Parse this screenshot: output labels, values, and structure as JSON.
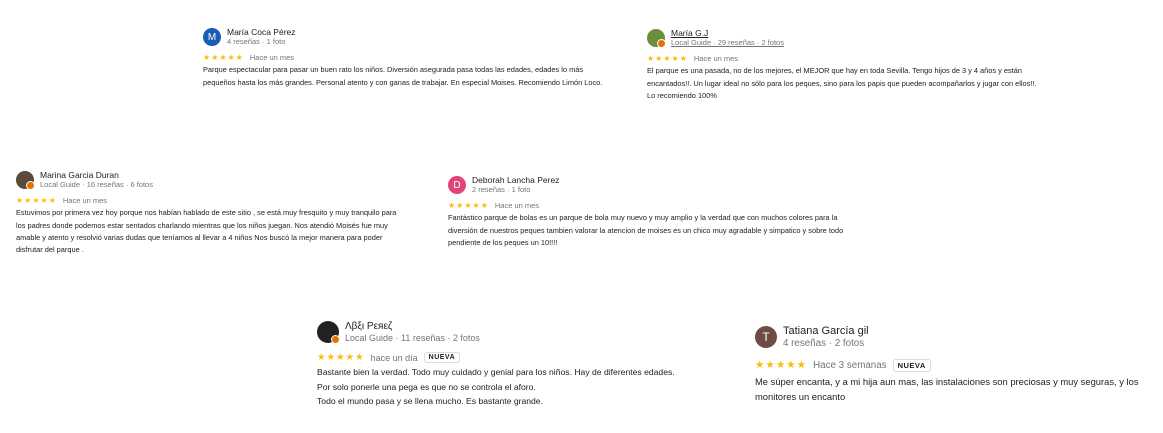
{
  "colors": {
    "stars": "#fbbc04",
    "meta": "#70757a",
    "text": "#202124"
  },
  "reviews": [
    {
      "name": "María Coca Pérez",
      "meta": "4 reseñas · 1 foto",
      "avatar_letter": "M",
      "avatar_color": "#1a5db4",
      "stars": "★★★★★",
      "rating": 5,
      "time": "Hace un mes",
      "text": "Parque espectacular para pasar un buen rato los niños. Diversión asegurada pasa todas las edades, edades lo más pequeños hasta los más grandes. Personal atento y con ganas de trabajar. En especial Moises. Recomiendo Limón Loco."
    },
    {
      "name": "María G.J",
      "meta": "Local Guide · 29 reseñas · 2 fotos",
      "avatar_letter": "",
      "avatar_color": "#6a8f3a",
      "stars": "★★★★★",
      "rating": 5,
      "time": "Hace un mes",
      "text": "El parque es una pasada, no de los mejores, el MEJOR que hay en toda Sevilla. Tengo hijos de 3 y 4 años y están encantados!!. Un lugar ideal no sólo para los peques, sino para los papis que pueden acompañarlos y jugar con ellos!!. Lo recomiendo 100%"
    },
    {
      "name": "Marina Garcia Duran",
      "meta": "Local Guide · 16 reseñas · 6 fotos",
      "avatar_letter": "",
      "avatar_color": "#5b4a3a",
      "stars": "★★★★★",
      "rating": 5,
      "time": "Hace un mes",
      "text": "Estuvimos por primera vez hoy  porque nos habían hablado de este sitio , se está muy fresquito y muy tranquilo para los padres donde podemos estar  sentados charlando mientras que los niños juegan. Nos atendió Moisés fue muy amable y atento y resolvió  varias dudas que teníamos al llevar a 4 niños   Nos buscó la mejor manera para poder disfrutar del parque ."
    },
    {
      "name": "Deborah Lancha Perez",
      "meta": "2 reseñas · 1 foto",
      "avatar_letter": "D",
      "avatar_color": "#e0447b",
      "stars": "★★★★★",
      "rating": 5,
      "time": "Hace un mes",
      "text": "Fantástico parque de bolas es un parque de bola muy nuevo y muy amplio y la verdad que con muchos colores para la diversión de nuestros peques tambien valorar la atencion de moises es un chico muy agradable y simpatico y sobre todo pendiente de los peques un 10!!!!"
    },
    {
      "name": "Λβξι Ρεяεζ",
      "meta": "Local Guide · 11 reseñas · 2 fotos",
      "avatar_letter": "",
      "avatar_color": "#222222",
      "stars": "★★★★★",
      "rating": 5,
      "time": "hace un día",
      "badge": "NUEVA",
      "text_lines": [
        "Bastante bien la verdad. Todo muy cuidado y genial para los niños. Hay de diferentes edades.",
        "Por solo ponerle una pega es que no se controla el aforo.",
        "Todo el mundo pasa y se llena mucho. Es bastante grande."
      ]
    },
    {
      "name": "Tatiana García gil",
      "meta": "4 reseñas · 2 fotos",
      "avatar_letter": "T",
      "avatar_color": "#6d4c41",
      "stars": "★★★★★",
      "rating": 5,
      "time": "Hace 3 semanas",
      "badge": "NUEVA",
      "text": "Me súper encanta, y a mi hija aun mas, las instalaciones son preciosas y muy seguras, y los monitores un encanto"
    }
  ]
}
